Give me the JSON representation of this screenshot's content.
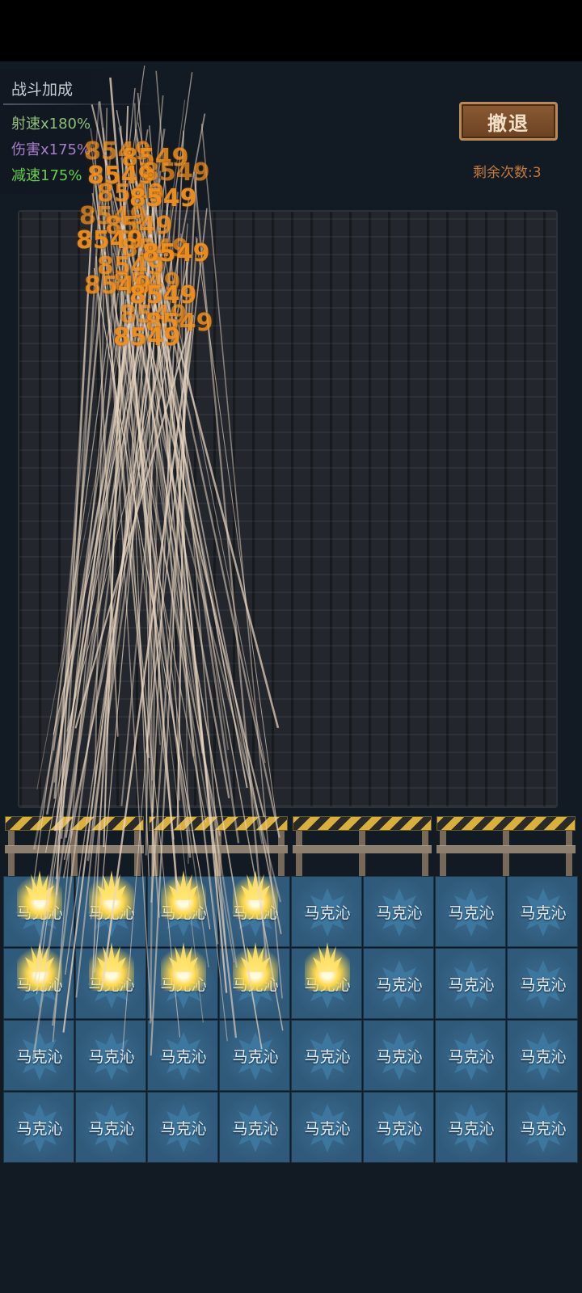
{
  "bonus": {
    "title": "战斗加成",
    "fire_rate": "射速x180%",
    "damage": "伤害x175%",
    "slow": "减速175%",
    "colors": {
      "fire_rate": "#8fbf7a",
      "damage": "#a67ec9",
      "slow": "#63d24a"
    }
  },
  "retreat_label": "撤退",
  "remaining_label": "剩余次数:3",
  "tile_label": "马克沁",
  "damage_number": "8549",
  "firing_tiles": [
    0,
    1,
    2,
    3,
    8,
    9,
    10,
    11,
    12
  ],
  "colors": {
    "damage_text": "#f0901e",
    "tile": "#305a7a",
    "accent": "#d8b03a"
  }
}
